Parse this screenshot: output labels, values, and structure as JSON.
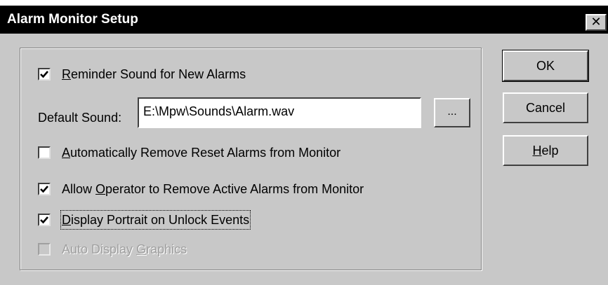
{
  "window": {
    "title": "Alarm Monitor Setup",
    "close_glyph": "✕"
  },
  "options": {
    "reminder_sound": {
      "label_prefix": "",
      "label_ul": "R",
      "label_rest": "eminder Sound for New Alarms",
      "checked": true
    },
    "default_sound": {
      "label": "Default Sound:",
      "value": "E:\\Mpw\\Sounds\\Alarm.wav",
      "browse_label": "..."
    },
    "auto_remove_reset": {
      "label_ul": "A",
      "label_rest": "utomatically Remove Reset Alarms from Monitor",
      "checked": false
    },
    "allow_operator": {
      "label_prefix": "Allow ",
      "label_ul": "O",
      "label_rest": "perator to Remove Active Alarms from Monitor",
      "checked": true
    },
    "display_portrait": {
      "label_ul": "D",
      "label_rest": "isplay Portrait on Unlock Events",
      "checked": true
    },
    "auto_display_graphics": {
      "label_prefix": "Auto Display ",
      "label_ul": "G",
      "label_rest": "raphics",
      "checked": false,
      "disabled": true
    }
  },
  "buttons": {
    "ok": "OK",
    "cancel": "Cancel",
    "help_ul": "H",
    "help_rest": "elp"
  },
  "icons": {
    "checkmark": "checkmark-icon",
    "close": "close-icon"
  }
}
